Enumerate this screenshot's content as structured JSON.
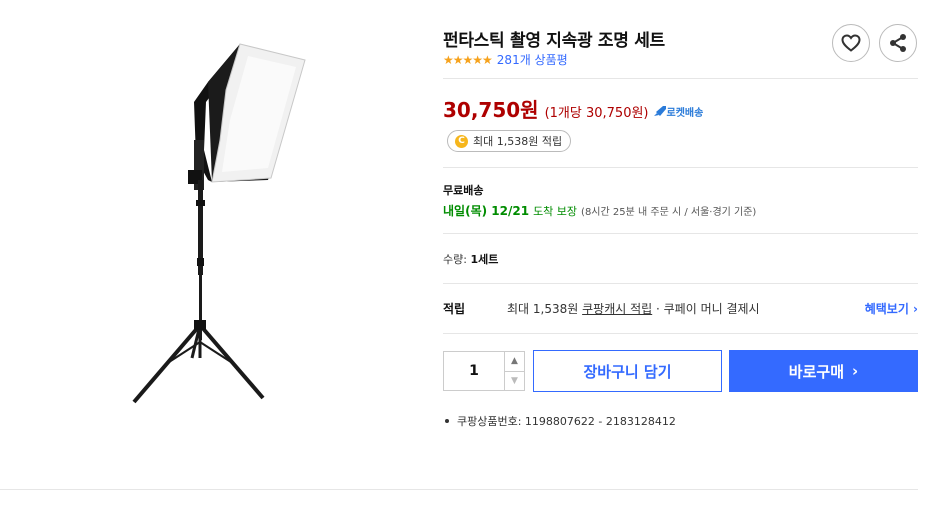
{
  "product": {
    "title": "펀타스틱 촬영 지속광 조명 세트",
    "stars": "★★★★★",
    "review_count": "281개 상품평"
  },
  "price": {
    "amount": "30,750원",
    "unit": "(1개당 30,750원)",
    "rocket_label": "로켓배송"
  },
  "points": {
    "coin": "C",
    "label": "최대 1,538원 적립"
  },
  "shipping": {
    "label": "무료배송",
    "date": "내일(목) 12/21",
    "guarantee": "도착 보장",
    "condition": "(8시간 25분  내 주문 시 / 서울⋅경기 기준)"
  },
  "quantity_info": {
    "label": "수량:",
    "value": "1세트"
  },
  "cash": {
    "title": "적립",
    "desc_prefix": "최대 1,538원",
    "desc_link": "쿠팡캐시 적립",
    "desc_suffix": "· 쿠페이 머니 결제시",
    "more": "혜택보기 ›"
  },
  "purchase": {
    "qty": "1",
    "cart_label": "장바구니 담기",
    "buy_label": "바로구매",
    "buy_chevron": "›"
  },
  "meta": {
    "product_no": "쿠팡상품번호: 1198807622 - 2183128412"
  },
  "colors": {
    "price_red": "#ae0000",
    "brand_blue": "#346aff",
    "delivery_green": "#008c00",
    "star_orange": "#f6a21c"
  },
  "icons": {
    "favorite": "heart-icon",
    "share": "share-icon",
    "rocket": "rocket-icon",
    "coin": "coin-icon"
  }
}
